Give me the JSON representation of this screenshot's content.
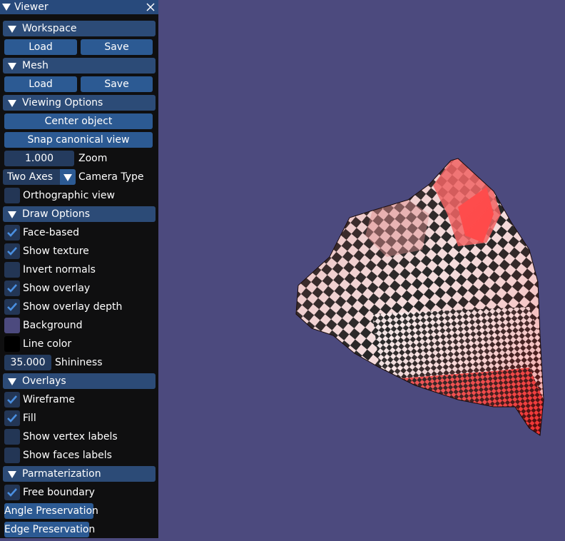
{
  "window": {
    "title": "Viewer"
  },
  "icons": {
    "collapse": "triangle-down-icon",
    "close": "close-icon",
    "check": "checkmark-icon"
  },
  "colors": {
    "viewport_background": "#4c4a7e",
    "panel_background": "#0f0f10",
    "header_background": "#2c4b77",
    "button_background": "#2c5a93",
    "check_color": "#4a8fe0",
    "line_color": "#000000"
  },
  "workspace": {
    "header": "Workspace",
    "load": "Load",
    "save": "Save"
  },
  "mesh": {
    "header": "Mesh",
    "load": "Load",
    "save": "Save"
  },
  "viewing": {
    "header": "Viewing Options",
    "center_object": "Center object",
    "snap_canonical": "Snap canonical view",
    "zoom_value": "1.000",
    "zoom_label": "Zoom",
    "camera_type_value": "Two Axes",
    "camera_type_label": "Camera Type",
    "orthographic": {
      "label": "Orthographic view",
      "checked": false
    }
  },
  "draw": {
    "header": "Draw Options",
    "face_based": {
      "label": "Face-based",
      "checked": true
    },
    "show_texture": {
      "label": "Show texture",
      "checked": true
    },
    "invert_normals": {
      "label": "Invert normals",
      "checked": false
    },
    "show_overlay": {
      "label": "Show overlay",
      "checked": true
    },
    "show_overlay_depth": {
      "label": "Show overlay depth",
      "checked": true
    },
    "background_label": "Background",
    "background_color": "#4c4a7e",
    "line_color_label": "Line color",
    "line_color": "#000000",
    "shininess_value": "35.000",
    "shininess_label": "Shininess"
  },
  "overlays": {
    "header": "Overlays",
    "wireframe": {
      "label": "Wireframe",
      "checked": true
    },
    "fill": {
      "label": "Fill",
      "checked": true
    },
    "vertex_labels": {
      "label": "Show vertex labels",
      "checked": false
    },
    "faces_labels": {
      "label": "Show faces labels",
      "checked": false
    }
  },
  "param": {
    "header": "Parmaterization",
    "free_boundary": {
      "label": "Free boundary",
      "checked": true
    },
    "angle_preservation": "Angle Preservation",
    "edge_preservation": "Edge Preservation"
  }
}
